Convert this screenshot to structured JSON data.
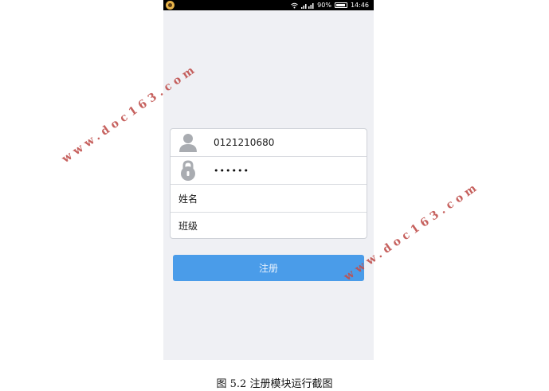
{
  "status_bar": {
    "signal_percent": "90%",
    "time": "14:46",
    "battery_level": 0.9
  },
  "form": {
    "account_value": "0121210680",
    "password_mask": "••••••",
    "name_placeholder": "姓名",
    "class_placeholder": "班级"
  },
  "register_button_label": "注册",
  "caption": "图 5.2 注册模块运行截图",
  "watermark": "www.doc163.com",
  "colors": {
    "button": "#4a9ce9",
    "background": "#eff0f4",
    "watermark": "#c0504d"
  },
  "icons": [
    "user-icon",
    "lock-icon",
    "wifi-icon",
    "signal-icon",
    "battery-icon"
  ]
}
